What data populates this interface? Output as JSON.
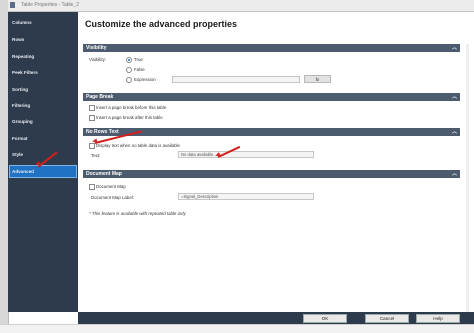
{
  "window": {
    "title": "Table Properties - Table_2"
  },
  "sidebar": {
    "items": [
      {
        "label": "Columns"
      },
      {
        "label": "Rows"
      },
      {
        "label": "Repeating"
      },
      {
        "label": "Peek Filters"
      },
      {
        "label": "Sorting"
      },
      {
        "label": "Filtering"
      },
      {
        "label": "Grouping"
      },
      {
        "label": "Format"
      },
      {
        "label": "Style"
      },
      {
        "label": "Advanced",
        "active": true
      }
    ]
  },
  "main": {
    "heading": "Customize the advanced properties",
    "visibility": {
      "title": "Visibility",
      "label": "Visibility:",
      "options": [
        "True",
        "False",
        "Expression"
      ],
      "selected": "True",
      "expression_value": "",
      "fx_label": "fx"
    },
    "page_break": {
      "title": "Page Break",
      "before_label": "Insert a page break before this table",
      "after_label": "Insert a page break after this table",
      "before_checked": false,
      "after_checked": false
    },
    "no_rows": {
      "title": "No Rows Text",
      "display_label": "Display text when no table data is available",
      "display_checked": false,
      "text_label": "Text:",
      "text_value": "No data available."
    },
    "document_map": {
      "title": "Document Map",
      "checkbox_label": "Document Map",
      "checked": false,
      "label_caption": "Document Map Label:",
      "label_value": "=Signal_Description",
      "note": "* This feature is available with repeated table only"
    }
  },
  "footer": {
    "ok": "OK",
    "cancel": "Cancel",
    "help": "Help"
  },
  "colors": {
    "sidebar": "#2e3b4c",
    "section_bar": "#4c5b6d",
    "active": "#1f72c4",
    "annotation_arrow": "#d61d1d"
  }
}
